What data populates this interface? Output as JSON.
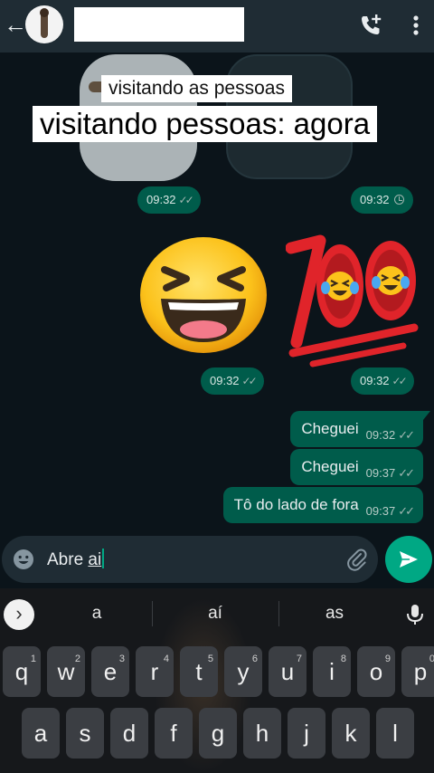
{
  "header": {
    "back_icon": "arrow-left-icon",
    "call_icon": "add-call-icon",
    "menu_icon": "more-vertical-icon"
  },
  "captions": {
    "line1": "visitando as pessoas",
    "line2": "visitando pessoas: agora"
  },
  "messages": [
    {
      "type": "sticker",
      "time": "09:32",
      "status": "read"
    },
    {
      "type": "sticker",
      "time": "09:32",
      "status": "pending"
    },
    {
      "type": "emoji",
      "emoji": "laughing-face",
      "time": "09:32",
      "status": "read"
    },
    {
      "type": "emoji",
      "emoji": "hundred-points-crying-laughing",
      "time": "09:32",
      "status": "read"
    },
    {
      "type": "text",
      "text": "Cheguei",
      "time": "09:32",
      "status": "read"
    },
    {
      "type": "text",
      "text": "Cheguei",
      "time": "09:37",
      "status": "read"
    },
    {
      "type": "text",
      "text": "Tô do lado de fora",
      "time": "09:37",
      "status": "read"
    }
  ],
  "composer": {
    "text_before": "Abre ",
    "text_underlined": "ai",
    "emoji_icon": "smiley-icon",
    "attach_icon": "paperclip-icon",
    "send_icon": "send-icon"
  },
  "keyboard": {
    "suggestions": [
      "a",
      "aí",
      "as"
    ],
    "row1": [
      {
        "key": "q",
        "hint": "1"
      },
      {
        "key": "w",
        "hint": "2"
      },
      {
        "key": "e",
        "hint": "3"
      },
      {
        "key": "r",
        "hint": "4"
      },
      {
        "key": "t",
        "hint": "5"
      },
      {
        "key": "y",
        "hint": "6"
      },
      {
        "key": "u",
        "hint": "7"
      },
      {
        "key": "i",
        "hint": "8"
      },
      {
        "key": "o",
        "hint": "9"
      },
      {
        "key": "p",
        "hint": "0"
      }
    ],
    "row2": [
      "a",
      "s",
      "d",
      "f",
      "g",
      "h",
      "j",
      "k",
      "l"
    ]
  },
  "colors": {
    "header_bg": "#1f2c34",
    "chat_bg": "#0b141a",
    "bubble_out": "#005c4b",
    "accent": "#00a884",
    "key_bg": "#3b3e43"
  }
}
